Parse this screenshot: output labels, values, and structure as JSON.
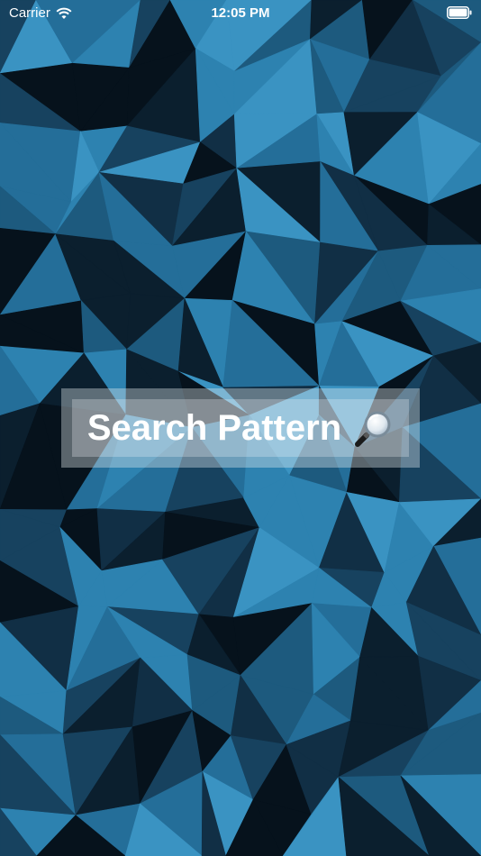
{
  "status_bar": {
    "carrier": "Carrier",
    "time": "12:05 PM",
    "wifi_icon": "wifi-icon",
    "battery_icon": "battery-icon"
  },
  "search": {
    "label": "Search Pattern",
    "icon": "magnifying-glass-icon"
  },
  "colors": {
    "background_dark": "#0f2a3d",
    "background_mid": "#1d5a7e",
    "background_light": "#3a8fba",
    "text": "#ffffff"
  }
}
